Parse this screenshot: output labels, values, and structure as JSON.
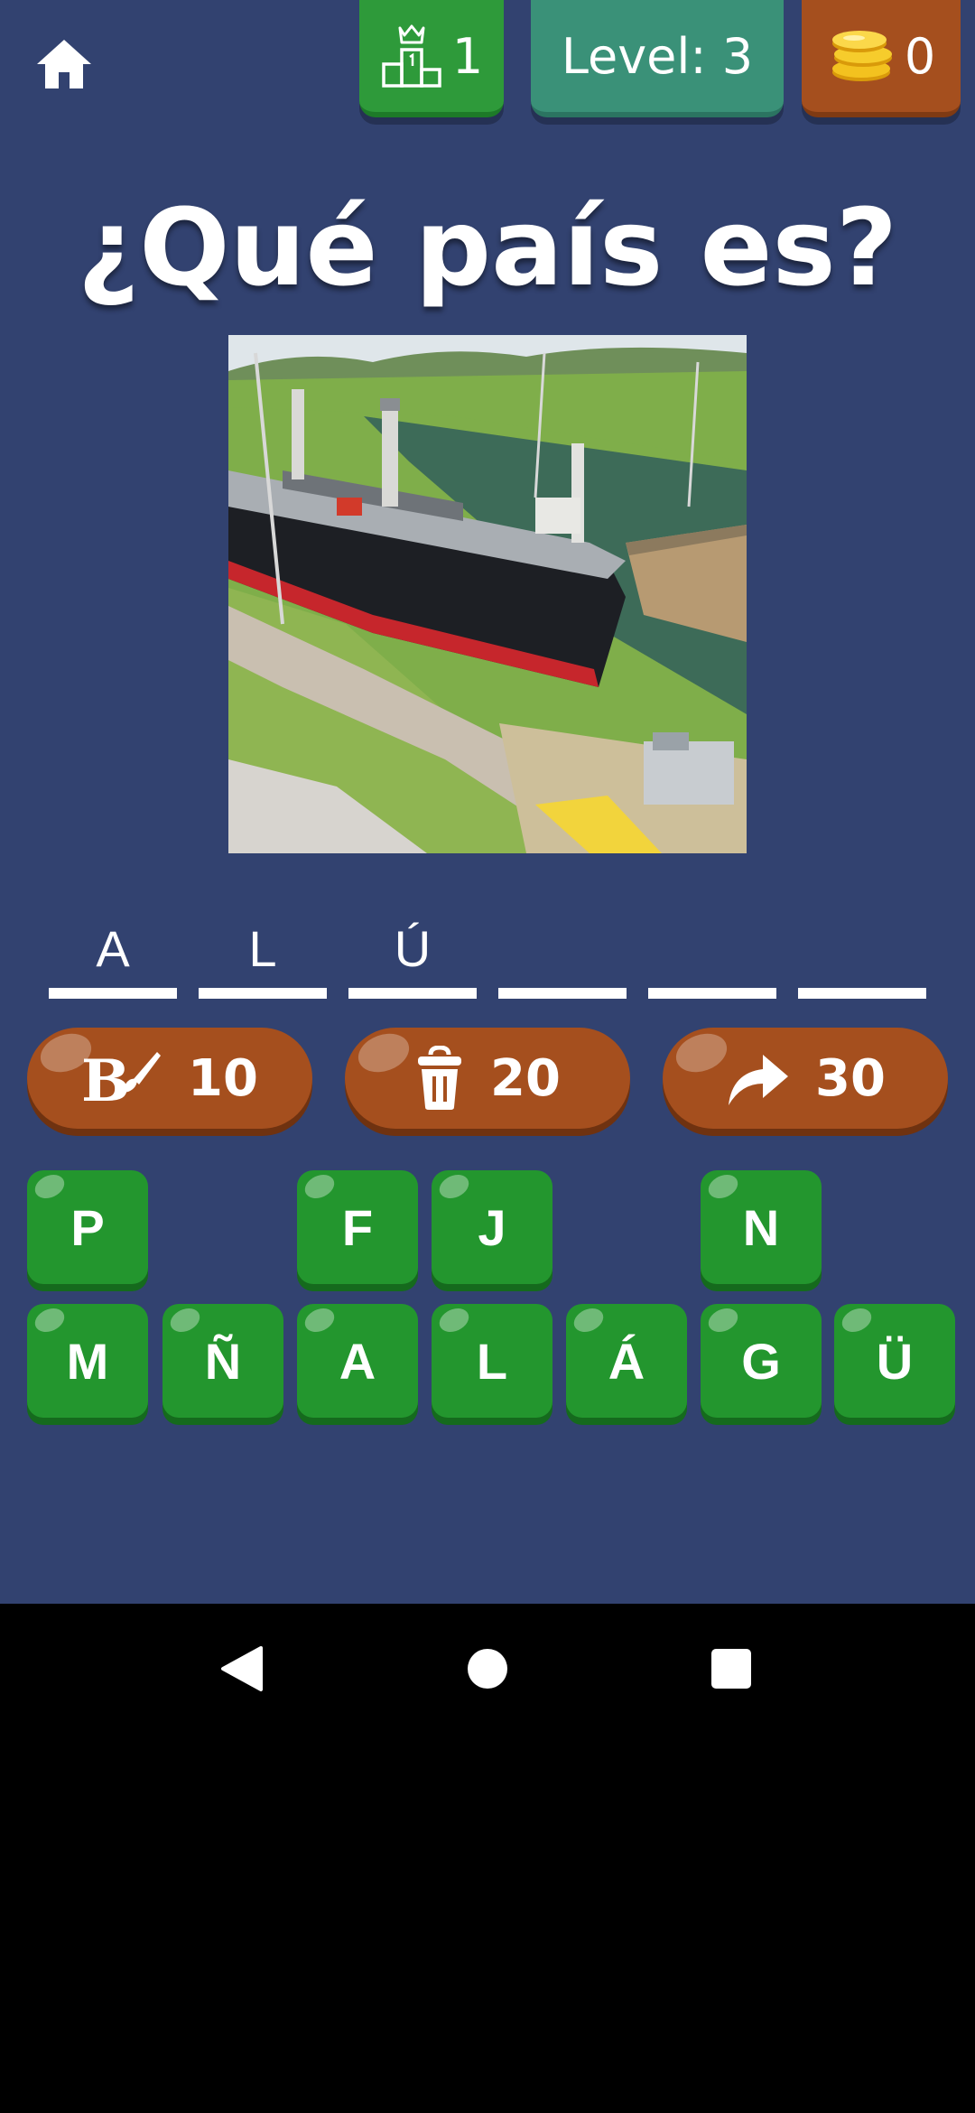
{
  "header": {
    "rank": "1",
    "level": "Level: 3",
    "coins": "0"
  },
  "title": "¿Qué país es?",
  "answer_slots": [
    "A",
    "L",
    "Ú",
    "",
    "",
    ""
  ],
  "helpers": [
    {
      "icon": "paint-brush-icon",
      "cost": "10"
    },
    {
      "icon": "trash-icon",
      "cost": "20"
    },
    {
      "icon": "skip-arrow-icon",
      "cost": "30"
    }
  ],
  "keys": {
    "row1": [
      "P",
      "",
      "F",
      "J",
      "",
      "N",
      ""
    ],
    "row2": [
      "M",
      "Ñ",
      "A",
      "L",
      "Á",
      "G",
      "Ü"
    ]
  },
  "colors": {
    "background": "#324270",
    "key_green": "#23962e",
    "helper_brown": "#a54f1e",
    "level_teal": "#3a9178"
  }
}
